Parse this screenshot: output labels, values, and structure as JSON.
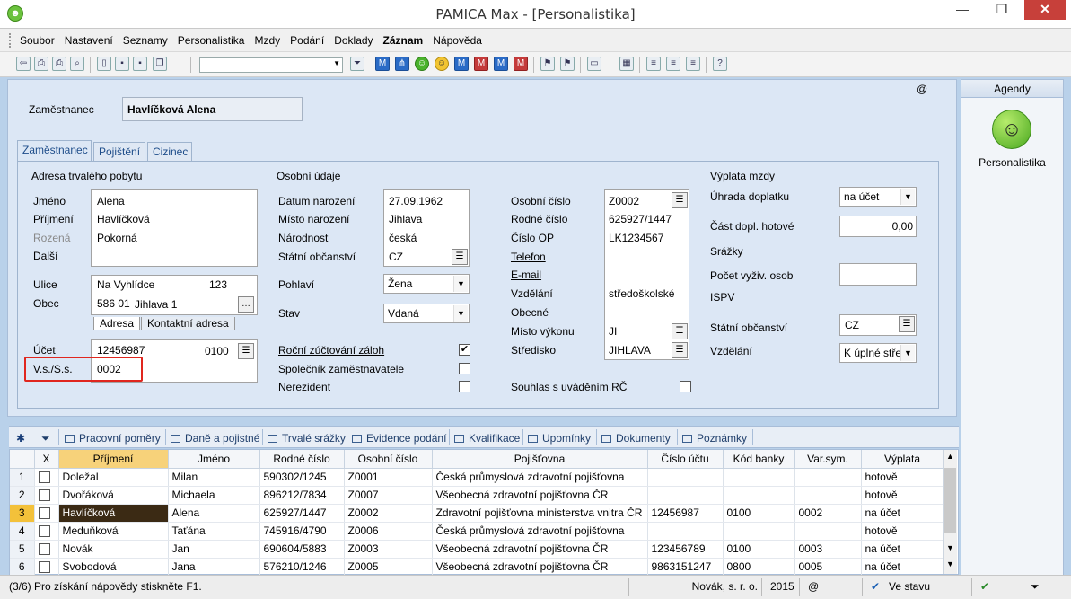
{
  "window": {
    "title": "PAMICA Max - [Personalistika]"
  },
  "menu": [
    "Soubor",
    "Nastavení",
    "Seznamy",
    "Personalistika",
    "Mzdy",
    "Podání",
    "Doklady",
    "Záznam",
    "Nápověda"
  ],
  "header": {
    "at_sign": "@",
    "employee_label": "Zaměstnanec",
    "employee_name": "Havlíčková Alena"
  },
  "tabs": [
    "Zaměstnanec",
    "Pojištění",
    "Cizinec"
  ],
  "address": {
    "section": "Adresa trvalého pobytu",
    "jmeno_label": "Jméno",
    "jmeno": "Alena",
    "prijmeni_label": "Příjmení",
    "prijmeni": "Havlíčková",
    "rozena_label": "Rozená",
    "rozena": "Pokorná",
    "dalsi_label": "Další",
    "ulice_label": "Ulice",
    "ulice": "Na Vyhlídce",
    "cislo": "123",
    "obec_label": "Obec",
    "psc": "586 01",
    "obec": "Jihlava 1",
    "tab_adresa": "Adresa",
    "tab_kontaktni": "Kontaktní adresa",
    "ucet_label": "Účet",
    "ucet": "12456987",
    "banka": "0100",
    "vs_label": "V.s./S.s.",
    "vs": "0002"
  },
  "personal": {
    "section": "Osobní údaje",
    "datum_label": "Datum narození",
    "datum": "27.09.1962",
    "misto_label": "Místo narození",
    "misto": "Jihlava",
    "narodnost_label": "Národnost",
    "narodnost": "česká",
    "obcanstvi_label": "Státní občanství",
    "obcanstvi": "CZ",
    "pohlavi_label": "Pohlaví",
    "pohlavi": "Žena",
    "stav_label": "Stav",
    "stav": "Vdaná",
    "rocni_label": "Roční zúčtování záloh",
    "spolecnik_label": "Společník zaměstnavatele",
    "nerezident_label": "Nerezident"
  },
  "ids": {
    "osobni_label": "Osobní číslo",
    "osobni": "Z0002",
    "rodne_label": "Rodné číslo",
    "rodne": "625927/1447",
    "op_label": "Číslo OP",
    "op": "LK1234567",
    "telefon_label": "Telefon",
    "email_label": "E-mail",
    "vzdelani_label": "Vzdělání",
    "vzdelani": "středoškolské",
    "obecne_label": "Obecné",
    "misto_label": "Místo výkonu",
    "misto": "JI",
    "stredisko_label": "Středisko",
    "stredisko": "JIHLAVA",
    "souhlas_label": "Souhlas s uváděním RČ"
  },
  "payout": {
    "section": "Výplata mzdy",
    "uhrada_label": "Úhrada doplatku",
    "uhrada": "na účet",
    "cast_label": "Část dopl. hotové",
    "cast": "0,00",
    "srazky_label": "Srážky",
    "pocet_label": "Počet vyživ. osob",
    "ispv_label": "ISPV",
    "obcanstvi_label": "Státní občanství",
    "obcanstvi": "CZ",
    "vzdelani_label": "Vzdělání",
    "vzdelani": "K úplné stře"
  },
  "agendy": {
    "title": "Agendy",
    "item": "Personalistika"
  },
  "bottom_tabs": [
    "Pracovní poměry",
    "Daně a pojistné",
    "Trvalé srážky",
    "Evidence podání",
    "Kvalifikace",
    "Upomínky",
    "Dokumenty",
    "Poznámky"
  ],
  "grid": {
    "columns": [
      "X",
      "Příjmení",
      "Jméno",
      "Rodné číslo",
      "Osobní číslo",
      "Pojišťovna",
      "Číslo účtu",
      "Kód banky",
      "Var.sym.",
      "Výplata"
    ],
    "rows": [
      [
        "1",
        "Doležal",
        "Milan",
        "590302/1245",
        "Z0001",
        "Česká průmyslová zdravotní pojišťovna",
        "",
        "",
        "",
        "hotově"
      ],
      [
        "2",
        "Dvořáková",
        "Michaela",
        "896212/7834",
        "Z0007",
        "Všeobecná zdravotní pojišťovna ČR",
        "",
        "",
        "",
        "hotově"
      ],
      [
        "3",
        "Havlíčková",
        "Alena",
        "625927/1447",
        "Z0002",
        "Zdravotní pojišťovna ministerstva vnitra ČR",
        "12456987",
        "0100",
        "0002",
        "na účet"
      ],
      [
        "4",
        "Meduňková",
        "Taťána",
        "745916/4790",
        "Z0006",
        "Česká průmyslová zdravotní pojišťovna",
        "",
        "",
        "",
        "hotově"
      ],
      [
        "5",
        "Novák",
        "Jan",
        "690604/5883",
        "Z0003",
        "Všeobecná zdravotní pojišťovna ČR",
        "123456789",
        "0100",
        "0003",
        "na účet"
      ],
      [
        "6",
        "Svobodová",
        "Jana",
        "576210/1246",
        "Z0005",
        "Všeobecná zdravotní pojišťovna ČR",
        "9863151247",
        "0800",
        "0005",
        "na účet"
      ]
    ]
  },
  "status": {
    "hint": "(3/6) Pro získání nápovědy stiskněte F1.",
    "company": "Novák, s. r. o.",
    "year": "2015",
    "at": "@",
    "state": "Ve stavu"
  }
}
